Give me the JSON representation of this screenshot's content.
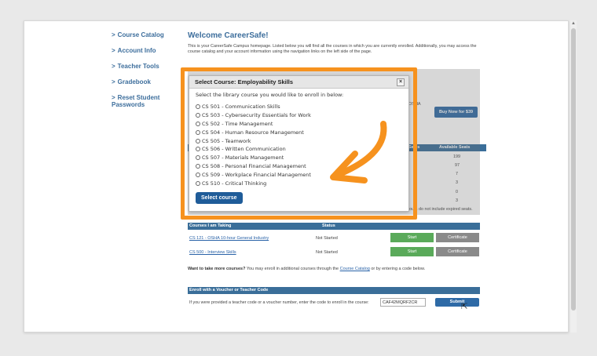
{
  "sidebar": {
    "items": [
      {
        "label": "Course Catalog"
      },
      {
        "label": "Account Info"
      },
      {
        "label": "Teacher Tools"
      },
      {
        "label": "Gradebook"
      },
      {
        "label": "Reset Student Passwords"
      }
    ]
  },
  "main": {
    "title": "Welcome CareerSafe!",
    "intro": "This is your CareerSafe Campus homepage. Listed below you will find all the courses in which you are currently enrolled. Additionally, you may access the course catalog and your account information using the navigation links on the left side of the page.",
    "buy_label": "Buy Now for $39",
    "partial_text": "OSHA",
    "seats_header": {
      "col_seats": "Seats",
      "col_available": "Available Seats"
    },
    "seat_values": [
      "199",
      "97",
      "7",
      "3",
      "0",
      "3"
    ],
    "seat_note": "ours do not include expired seats."
  },
  "courses": {
    "header": {
      "col1": "Courses I am Taking",
      "col2": "Status"
    },
    "rows": [
      {
        "name": "CS 121 - OSHA 10-hour General Industry",
        "status": "Not Started",
        "start": "Start",
        "cert": "Certificate"
      },
      {
        "name": "CS 500 - Interview Skills",
        "status": "Not Started",
        "start": "Start",
        "cert": "Certificate"
      }
    ]
  },
  "more": {
    "bold": "Want to take more courses?",
    "text1": " You may enroll in additional courses through the ",
    "link": "Course Catalog",
    "text2": " or by entering a code below."
  },
  "enroll": {
    "header": "Enroll with a Voucher or Teacher Code",
    "text": "If you were provided a teacher code or a voucher number, enter the code to enroll in the course:",
    "value": "CAF42MQRF2CR",
    "submit": "Submit"
  },
  "modal": {
    "title": "Select Course: Employability Skills",
    "close": "×",
    "instruction": "Select the library course you would like to enroll in below:",
    "options": [
      "CS 501 - Communication Skills",
      "CS 503 - Cybersecurity Essentials for Work",
      "CS 502 - Time Management",
      "CS 504 - Human Resource Management",
      "CS 505 - Teamwork",
      "CS 506 - Written Communication",
      "CS 507 - Materials Management",
      "CS 508 - Personal Financial Management",
      "CS 509 - Workplace Financial Management",
      "CS 510 - Critical Thinking"
    ],
    "button": "Select course"
  },
  "colors": {
    "accent": "#3d6e9c",
    "highlight": "#f6921e",
    "start": "#5aaa5a",
    "button": "#1f5c99"
  }
}
